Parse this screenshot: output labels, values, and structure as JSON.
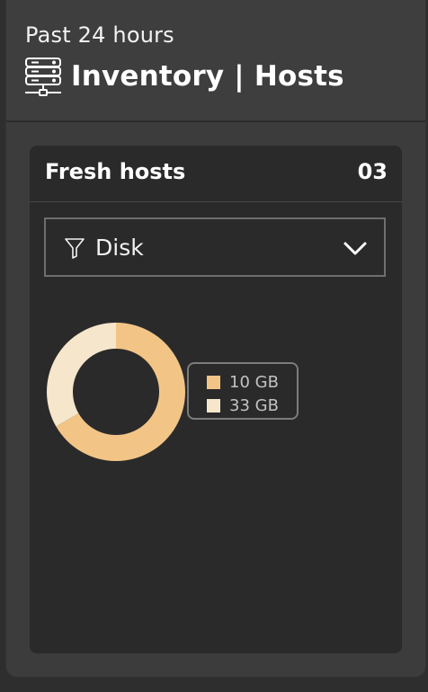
{
  "header": {
    "subtitle": "Past 24 hours",
    "title": "Inventory | Hosts",
    "icon": "server-rack-icon"
  },
  "card": {
    "title": "Fresh hosts",
    "count": "03",
    "filter": {
      "icon": "funnel-icon",
      "selected": "Disk",
      "chevron_icon": "chevron-down-icon"
    }
  },
  "colors": {
    "series_1": "#f2c586",
    "series_2": "#f5e6cc",
    "card_bg": "#2a2a2a",
    "panel_bg": "#3c3c3c"
  },
  "chart_data": {
    "type": "pie",
    "donut": true,
    "categories": [
      "10 GB",
      "33 GB"
    ],
    "values": [
      2,
      1
    ],
    "legend": [
      "10 GB",
      "33 GB"
    ],
    "legend_position": "right"
  }
}
